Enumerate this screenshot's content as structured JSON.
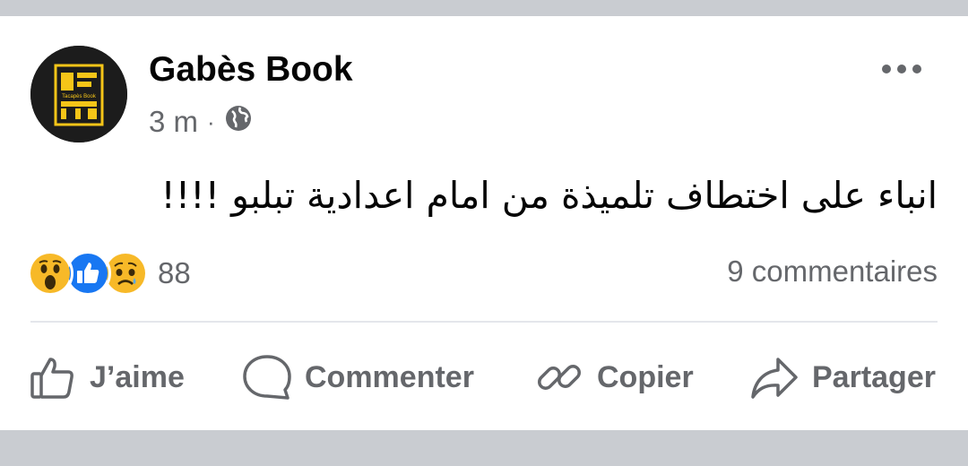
{
  "post": {
    "page_name": "Gabès Book",
    "time": "3 m",
    "separator": "·",
    "privacy_icon": "globe-icon",
    "text": "انباء على اختطاف تلميذة من امام اعدادية تبلبو !!!!",
    "avatar_logo_text": "Tacapès Book"
  },
  "stats": {
    "reaction_icons": [
      "wow-reaction-icon",
      "like-reaction-icon",
      "sad-reaction-icon"
    ],
    "reaction_count": "88",
    "comments_label": "9 commentaires"
  },
  "actions": {
    "like": "J’aime",
    "comment": "Commenter",
    "copy": "Copier",
    "share": "Partager"
  },
  "colors": {
    "text_primary": "#050505",
    "text_secondary": "#65676b",
    "like_blue": "#1877f2",
    "logo_yellow": "#f5c518",
    "background": "#c9ccd1"
  }
}
